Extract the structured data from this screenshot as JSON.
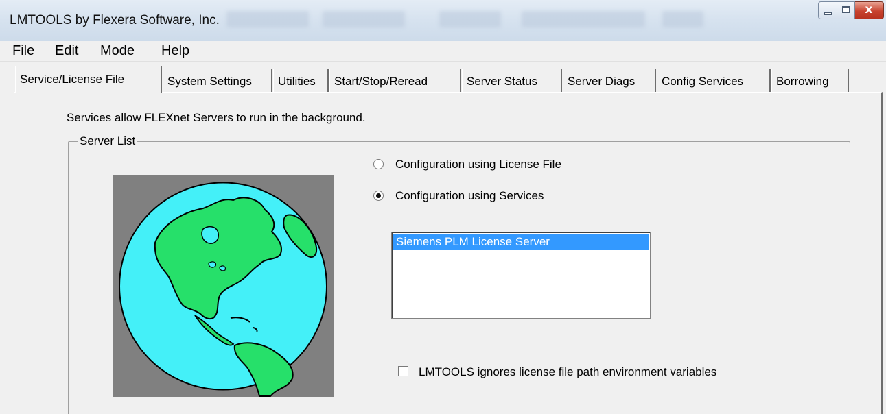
{
  "window": {
    "title": "LMTOOLS by Flexera Software, Inc.",
    "close_glyph": "x"
  },
  "menu": [
    "File",
    "Edit",
    "Mode",
    "Help"
  ],
  "tabs": [
    "Service/License File",
    "System Settings",
    "Utilities",
    "Start/Stop/Reread",
    "Server Status",
    "Server Diags",
    "Config Services",
    "Borrowing"
  ],
  "active_tab": "Service/License File",
  "panel": {
    "description": "Services allow FLEXnet Servers to run in the background.",
    "groupbox_label": "Server List",
    "globe_image": "flexnet-globe-icon",
    "radio_options": [
      {
        "label": "Configuration using License File",
        "checked": false
      },
      {
        "label": "Configuration using Services",
        "checked": true
      }
    ],
    "services": [
      "Siemens PLM License Server"
    ],
    "selected_service": "Siemens PLM License Server",
    "ignore_env_vars": {
      "label": "LMTOOLS ignores license file path environment variables",
      "checked": false
    }
  },
  "colors": {
    "selection": "#3399ff",
    "globe_ocean": "#44f0f8",
    "globe_land": "#26e06a",
    "image_background": "#808080"
  }
}
